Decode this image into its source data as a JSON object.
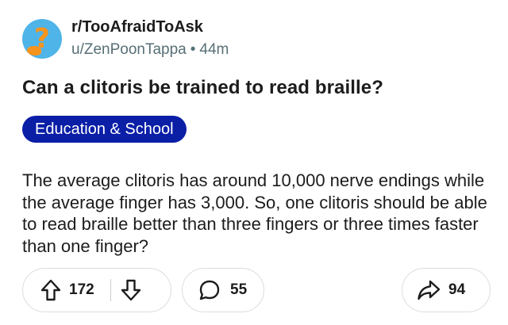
{
  "post": {
    "subreddit": "r/TooAfraidToAsk",
    "author": "u/ZenPoonTappa",
    "separator": "•",
    "age": "44m",
    "title": "Can a clitoris be trained to read braille?",
    "flair": "Education & School",
    "body": "The average clitoris has around 10,000 nerve endings while the average finger has 3,000. So, one clitoris should be able to read braille better than three fingers or three times faster than one finger?"
  },
  "actions": {
    "upvotes": "172",
    "comments": "55",
    "shares": "94"
  },
  "icons": {
    "avatar": "question-mark-avatar-icon",
    "upvote": "upvote-arrow-icon",
    "downvote": "downvote-arrow-icon",
    "comment": "comment-bubble-icon",
    "share": "share-arrow-icon"
  },
  "colors": {
    "flair_background": "#0a1ea6",
    "avatar_background": "#4fb4e8",
    "avatar_accent": "#f7941d",
    "muted_text": "#576f76"
  }
}
